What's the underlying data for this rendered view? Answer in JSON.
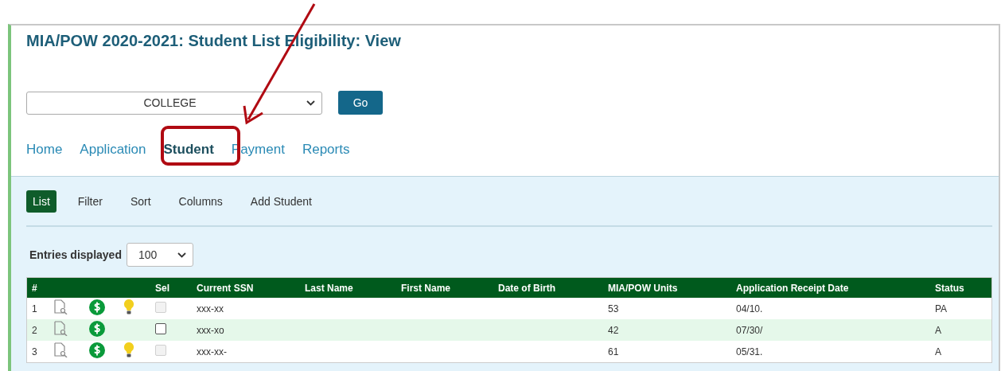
{
  "title": "MIA/POW 2020-2021: Student List Eligibility: View",
  "college_select": {
    "value": "COLLEGE"
  },
  "go_button": "Go",
  "nav_tabs": [
    {
      "label": "Home",
      "selected": false
    },
    {
      "label": "Application",
      "selected": false
    },
    {
      "label": "Student",
      "selected": true
    },
    {
      "label": "Payment",
      "selected": false
    },
    {
      "label": "Reports",
      "selected": false
    }
  ],
  "sub_tabs": [
    {
      "label": "List",
      "selected": true
    },
    {
      "label": "Filter",
      "selected": false
    },
    {
      "label": "Sort",
      "selected": false
    },
    {
      "label": "Columns",
      "selected": false
    },
    {
      "label": "Add Student",
      "selected": false
    }
  ],
  "entries": {
    "label": "Entries displayed",
    "value": "100"
  },
  "table": {
    "columns": [
      "#",
      "",
      "",
      "",
      "Sel",
      "Current SSN",
      "Last Name",
      "First Name",
      "Date of Birth",
      "MIA/POW Units",
      "Application Receipt Date",
      "Status"
    ],
    "rows": [
      {
        "number": "1",
        "tip": true,
        "sel_disabled": true,
        "checked": false,
        "ssn": "xxx-xx",
        "units": "53",
        "receipt_date": "04/10.",
        "status": "PA"
      },
      {
        "number": "2",
        "tip": false,
        "sel_disabled": false,
        "checked": false,
        "ssn": "xxx-xo",
        "units": "42",
        "receipt_date": "07/30/",
        "status": "A"
      },
      {
        "number": "3",
        "tip": true,
        "sel_disabled": true,
        "checked": false,
        "ssn": "xxx-xx-",
        "units": "61",
        "receipt_date": "05/31.",
        "status": "A"
      }
    ]
  }
}
